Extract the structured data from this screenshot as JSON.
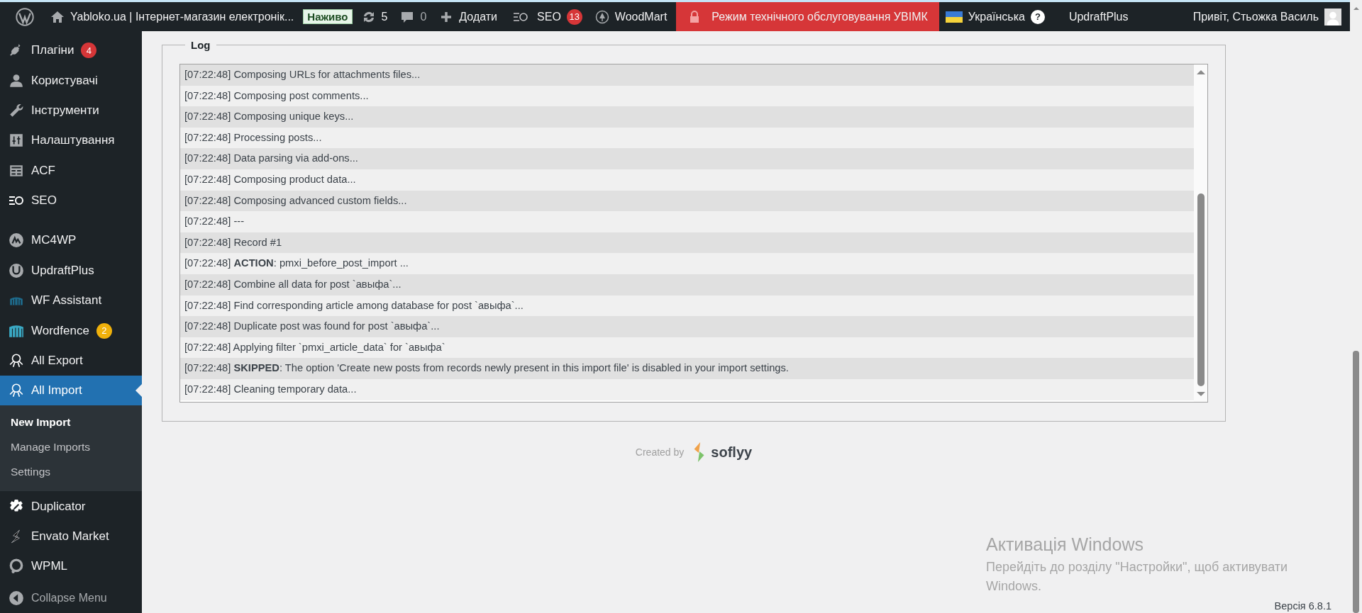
{
  "admin_bar": {
    "site_title": "Yabloko.ua | Інтернет-магазин електронік...",
    "live_badge": "Наживо",
    "updates_count": "5",
    "comments_count": "0",
    "new_label": "Додати",
    "seo_label": "SEO",
    "seo_badge": "13",
    "woodmart_label": "WoodMart",
    "maintenance_label": "Режим технічного обслуговування УВІМК",
    "language_label": "Українська",
    "help_label": "?",
    "updraft_label": "UpdraftPlus",
    "greeting": "Привіт, Стьожка Василь"
  },
  "sidebar": {
    "items": [
      {
        "kind": "item",
        "label": "Плагіни",
        "badge": {
          "text": "4",
          "color": "#d63638"
        },
        "selected": false
      },
      {
        "kind": "item",
        "label": "Користувачі",
        "selected": false
      },
      {
        "kind": "item",
        "label": "Інструменти",
        "selected": false
      },
      {
        "kind": "item",
        "label": "Налаштування",
        "selected": false
      },
      {
        "kind": "item",
        "label": "ACF",
        "selected": false
      },
      {
        "kind": "item",
        "label": "SEO",
        "selected": false
      },
      {
        "kind": "separator"
      },
      {
        "kind": "item",
        "label": "MC4WP",
        "selected": false
      },
      {
        "kind": "item",
        "label": "UpdraftPlus",
        "selected": false
      },
      {
        "kind": "item",
        "label": "WF Assistant",
        "selected": false
      },
      {
        "kind": "item",
        "label": "Wordfence",
        "badge": {
          "text": "2",
          "color": "#f0b10b"
        },
        "selected": false
      },
      {
        "kind": "item",
        "label": "All Export",
        "selected": false
      },
      {
        "kind": "item",
        "label": "All Import",
        "selected": true,
        "children": [
          {
            "label": "New Import",
            "selected": true
          },
          {
            "label": "Manage Imports",
            "selected": false
          },
          {
            "label": "Settings",
            "selected": false
          }
        ]
      },
      {
        "kind": "item",
        "label": "Duplicator",
        "selected": false
      },
      {
        "kind": "item",
        "label": "Envato Market",
        "selected": false
      },
      {
        "kind": "item",
        "label": "WPML",
        "selected": false
      }
    ],
    "collapse_label": "Collapse Menu"
  },
  "log": {
    "legend": "Log",
    "lines": [
      "[07:22:48] Composing URLs for attachments files...",
      "[07:22:48] Composing post comments...",
      "[07:22:48] Composing unique keys...",
      "[07:22:48] Processing posts...",
      "[07:22:48] Data parsing via add-ons...",
      "[07:22:48] Composing product data...",
      "[07:22:48] Composing advanced custom fields...",
      "[07:22:48] ---",
      "[07:22:48] Record #1",
      "[07:22:48] **ACTION**: pmxi_before_post_import ...",
      "[07:22:48] Combine all data for post `авыфа`...",
      "[07:22:48] Find corresponding article among database for post `авыфа`...",
      "[07:22:48] Duplicate post was found for post `авыфа`...",
      "[07:22:48] Applying filter `pmxi_article_data` for `авыфа`",
      "[07:22:48] **SKIPPED**: The option 'Create new posts from records newly present in this import file' is disabled in your import settings.",
      "[07:22:48] Cleaning temporary data..."
    ]
  },
  "footer": {
    "created_by": "Created by",
    "brand": "soflyy",
    "version": "Версія 6.8.1"
  },
  "windows_notice": {
    "title": "Активація Windows",
    "text": "Перейдіть до розділу \"Настройки\", щоб активувати Windows."
  }
}
